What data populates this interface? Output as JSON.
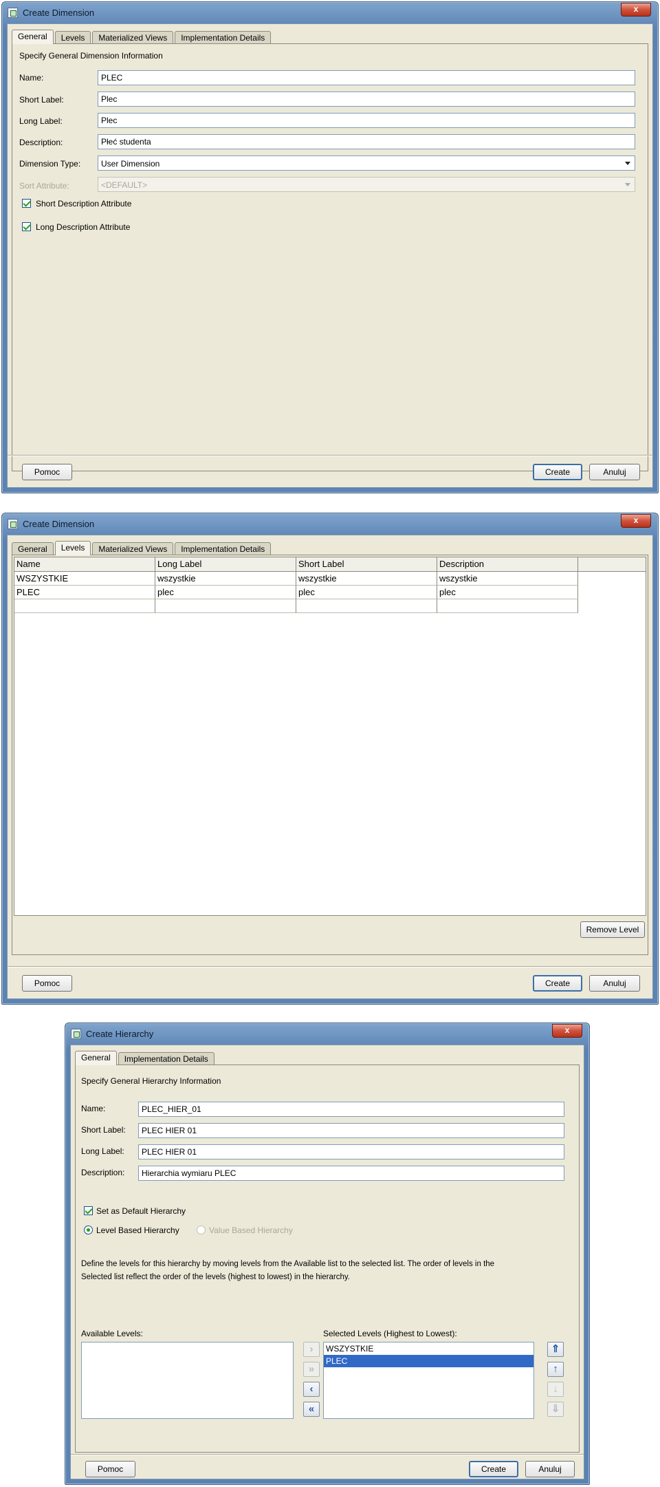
{
  "dialog1": {
    "title": "Create Dimension",
    "close": "x",
    "tabs": [
      "General",
      "Levels",
      "Materialized Views",
      "Implementation Details"
    ],
    "heading": "Specify General Dimension Information",
    "name_label": "Name:",
    "name_value": "PLEC",
    "short_label": "Short Label:",
    "short_value": "Plec",
    "long_label": "Long Label:",
    "long_value": "Plec",
    "desc_label": "Description:",
    "desc_value": "Płeć studenta",
    "dimtype_label": "Dimension Type:",
    "dimtype_value": "User Dimension",
    "sort_label": "Sort Attribute:",
    "sort_value": "<DEFAULT>",
    "short_desc_attr": "Short Description Attribute",
    "long_desc_attr": "Long Description Attribute",
    "help": "Pomoc",
    "create": "Create",
    "cancel": "Anuluj"
  },
  "dialog2": {
    "title": "Create Dimension",
    "close": "x",
    "tabs": [
      "General",
      "Levels",
      "Materialized Views",
      "Implementation Details"
    ],
    "columns": [
      "Name",
      "Long Label",
      "Short Label",
      "Description"
    ],
    "rows": [
      [
        "WSZYSTKIE",
        "wszystkie",
        "wszystkie",
        "wszystkie"
      ],
      [
        "PLEC",
        "plec",
        "plec",
        "plec"
      ],
      [
        "",
        "",
        "",
        ""
      ]
    ],
    "remove_level": "Remove Level",
    "help": "Pomoc",
    "create": "Create",
    "cancel": "Anuluj"
  },
  "dialog3": {
    "title": "Create Hierarchy",
    "close": "x",
    "tabs": [
      "General",
      "Implementation Details"
    ],
    "heading": "Specify General Hierarchy Information",
    "name_label": "Name:",
    "name_value": "PLEC_HIER_01",
    "short_label": "Short Label:",
    "short_value": "PLEC HIER 01",
    "long_label": "Long Label:",
    "long_value": "PLEC HIER 01",
    "desc_label": "Description:",
    "desc_value": "Hierarchia wymiaru PLEC",
    "default_hier": "Set as Default Hierarchy",
    "level_based": "Level Based Hierarchy",
    "value_based": "Value Based Hierarchy",
    "instructions_1": "Define the levels for this hierarchy by moving levels from the Available list to the selected list. The order of levels in the",
    "instructions_2": "Selected list reflect the order of the levels (highest to lowest) in the hierarchy.",
    "available_label": "Available Levels:",
    "selected_label": "Selected Levels (Highest to Lowest):",
    "selected_items": [
      "WSZYSTKIE",
      "PLEC"
    ],
    "help": "Pomoc",
    "create": "Create",
    "cancel": "Anuluj"
  }
}
